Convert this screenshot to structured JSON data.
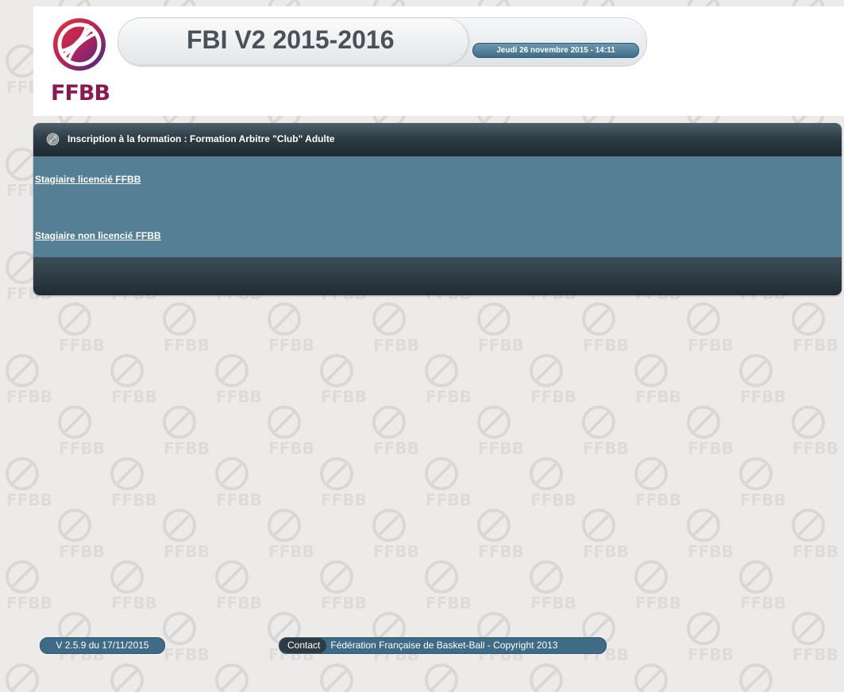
{
  "header": {
    "logo_text": "FFBB",
    "app_title": "FBI V2 2015-2016",
    "date_time": "Jeudi 26 novembre 2015 - 14:11"
  },
  "panel": {
    "title": "Inscription à la formation : Formation Arbitre \"Club\" Adulte",
    "links": [
      {
        "label": "Stagiaire licencié FFBB"
      },
      {
        "label": "Stagiaire non licencié FFBB"
      }
    ]
  },
  "footer": {
    "version": "V 2.5.9 du 17/11/2015",
    "contact_label": "Contact",
    "copyright": "Fédération Française de Basket-Ball - Copyright 2013"
  },
  "colors": {
    "brand": "#8b1a50",
    "panel_body": "#557f94",
    "panel_header": "#2e3d45",
    "pill_blue": "#3f6b87"
  }
}
